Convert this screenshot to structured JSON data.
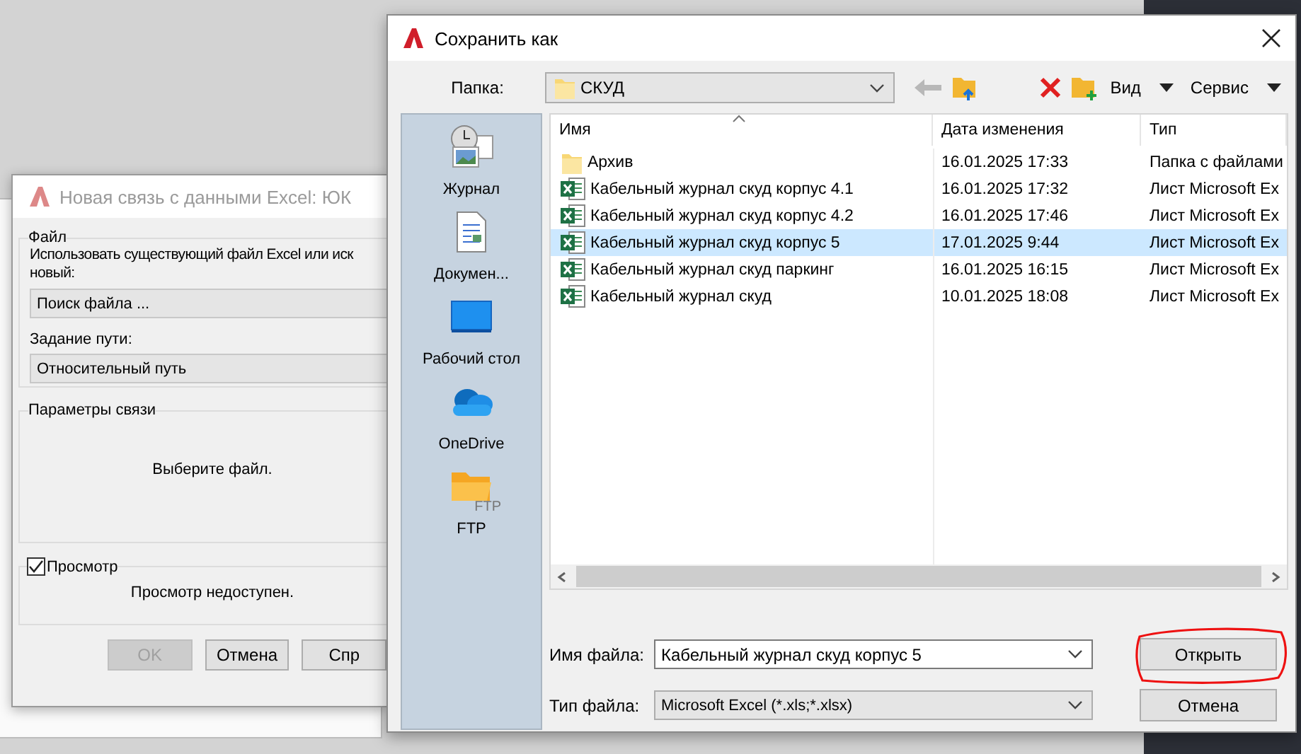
{
  "link_dialog": {
    "title": "Новая связь с данными Excel: ЮК",
    "active": false,
    "file_group": {
      "label": "Файл",
      "description_lines": [
        "Использовать существующий файл Excel или иск",
        "новый:"
      ],
      "file_select": "Поиск файла ...",
      "path_label": "Задание пути:",
      "path_select": "Относительный путь"
    },
    "link_params": {
      "label": "Параметры связи",
      "message": "Выберите файл."
    },
    "preview": {
      "label": "Просмотр",
      "checked": true,
      "message": "Просмотр недоступен."
    },
    "buttons": [
      {
        "label": "OK",
        "disabled": true
      },
      {
        "label": "Отмена",
        "disabled": false
      },
      {
        "label": "Спр",
        "disabled": false
      }
    ]
  },
  "save_dialog": {
    "title": "Сохранить как",
    "folder_label": "Папка:",
    "folder": "СКУД",
    "toolbar": [
      {
        "kind": "back",
        "disabled": true
      },
      {
        "kind": "up",
        "disabled": false
      },
      {
        "kind": "delete",
        "disabled": false
      },
      {
        "kind": "new-folder",
        "disabled": false
      },
      {
        "kind": "menu",
        "label": "Вид",
        "disabled": false
      },
      {
        "kind": "menu",
        "label": "Сервис",
        "disabled": false
      }
    ],
    "places": [
      {
        "kind": "history",
        "label": "Журнал"
      },
      {
        "kind": "documents",
        "label": "Докумен..."
      },
      {
        "kind": "desktop",
        "label": "Рабочий стол"
      },
      {
        "kind": "cloud",
        "label": "OneDrive"
      },
      {
        "kind": "ftp",
        "label": "FTP",
        "badge": "FTP"
      }
    ],
    "columns": [
      "Имя",
      "Дата изменения",
      "Тип"
    ],
    "rows": [
      {
        "kind": "folder",
        "name": "Архив",
        "date": "16.01.2025 17:33",
        "type": "Папка с файлами",
        "selected": false
      },
      {
        "kind": "excel",
        "name": "Кабельный журнал скуд корпус 4.1",
        "date": "16.01.2025 17:32",
        "type": "Лист Microsoft Ex",
        "selected": false
      },
      {
        "kind": "excel",
        "name": "Кабельный журнал скуд корпус 4.2",
        "date": "16.01.2025 17:46",
        "type": "Лист Microsoft Ex",
        "selected": false
      },
      {
        "kind": "excel",
        "name": "Кабельный журнал скуд корпус 5",
        "date": "17.01.2025 9:44",
        "type": "Лист Microsoft Ex",
        "selected": true
      },
      {
        "kind": "excel",
        "name": "Кабельный журнал скуд паркинг",
        "date": "16.01.2025 16:15",
        "type": "Лист Microsoft Ex",
        "selected": false
      },
      {
        "kind": "excel",
        "name": "Кабельный журнал скуд",
        "date": "10.01.2025 18:08",
        "type": "Лист Microsoft Ex",
        "selected": false
      }
    ],
    "filename_label": "Имя файла:",
    "filename": "Кабельный журнал скуд корпус 5",
    "filetype_label": "Тип файла:",
    "filetype": "Microsoft Excel (*.xls;*.xlsx)",
    "buttons": [
      {
        "label": "Открыть",
        "highlighted": true
      },
      {
        "label": "Отмена",
        "highlighted": false
      }
    ]
  }
}
